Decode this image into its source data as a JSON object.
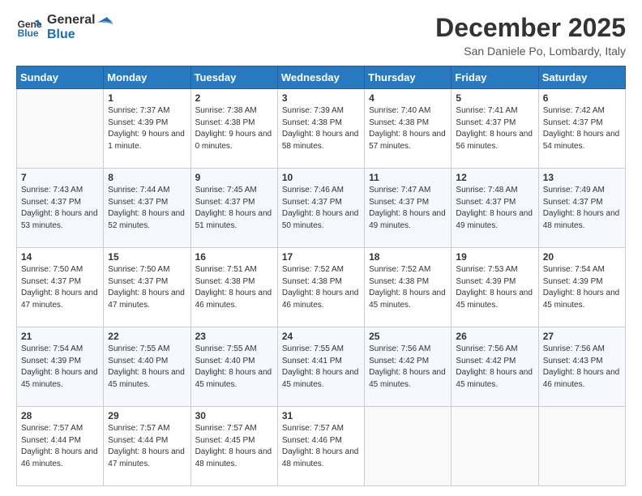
{
  "header": {
    "logo_line1": "General",
    "logo_line2": "Blue",
    "month": "December 2025",
    "location": "San Daniele Po, Lombardy, Italy"
  },
  "weekdays": [
    "Sunday",
    "Monday",
    "Tuesday",
    "Wednesday",
    "Thursday",
    "Friday",
    "Saturday"
  ],
  "weeks": [
    [
      {
        "day": "",
        "sunrise": "",
        "sunset": "",
        "daylight": ""
      },
      {
        "day": "1",
        "sunrise": "Sunrise: 7:37 AM",
        "sunset": "Sunset: 4:39 PM",
        "daylight": "Daylight: 9 hours and 1 minute."
      },
      {
        "day": "2",
        "sunrise": "Sunrise: 7:38 AM",
        "sunset": "Sunset: 4:38 PM",
        "daylight": "Daylight: 9 hours and 0 minutes."
      },
      {
        "day": "3",
        "sunrise": "Sunrise: 7:39 AM",
        "sunset": "Sunset: 4:38 PM",
        "daylight": "Daylight: 8 hours and 58 minutes."
      },
      {
        "day": "4",
        "sunrise": "Sunrise: 7:40 AM",
        "sunset": "Sunset: 4:38 PM",
        "daylight": "Daylight: 8 hours and 57 minutes."
      },
      {
        "day": "5",
        "sunrise": "Sunrise: 7:41 AM",
        "sunset": "Sunset: 4:37 PM",
        "daylight": "Daylight: 8 hours and 56 minutes."
      },
      {
        "day": "6",
        "sunrise": "Sunrise: 7:42 AM",
        "sunset": "Sunset: 4:37 PM",
        "daylight": "Daylight: 8 hours and 54 minutes."
      }
    ],
    [
      {
        "day": "7",
        "sunrise": "Sunrise: 7:43 AM",
        "sunset": "Sunset: 4:37 PM",
        "daylight": "Daylight: 8 hours and 53 minutes."
      },
      {
        "day": "8",
        "sunrise": "Sunrise: 7:44 AM",
        "sunset": "Sunset: 4:37 PM",
        "daylight": "Daylight: 8 hours and 52 minutes."
      },
      {
        "day": "9",
        "sunrise": "Sunrise: 7:45 AM",
        "sunset": "Sunset: 4:37 PM",
        "daylight": "Daylight: 8 hours and 51 minutes."
      },
      {
        "day": "10",
        "sunrise": "Sunrise: 7:46 AM",
        "sunset": "Sunset: 4:37 PM",
        "daylight": "Daylight: 8 hours and 50 minutes."
      },
      {
        "day": "11",
        "sunrise": "Sunrise: 7:47 AM",
        "sunset": "Sunset: 4:37 PM",
        "daylight": "Daylight: 8 hours and 49 minutes."
      },
      {
        "day": "12",
        "sunrise": "Sunrise: 7:48 AM",
        "sunset": "Sunset: 4:37 PM",
        "daylight": "Daylight: 8 hours and 49 minutes."
      },
      {
        "day": "13",
        "sunrise": "Sunrise: 7:49 AM",
        "sunset": "Sunset: 4:37 PM",
        "daylight": "Daylight: 8 hours and 48 minutes."
      }
    ],
    [
      {
        "day": "14",
        "sunrise": "Sunrise: 7:50 AM",
        "sunset": "Sunset: 4:37 PM",
        "daylight": "Daylight: 8 hours and 47 minutes."
      },
      {
        "day": "15",
        "sunrise": "Sunrise: 7:50 AM",
        "sunset": "Sunset: 4:37 PM",
        "daylight": "Daylight: 8 hours and 47 minutes."
      },
      {
        "day": "16",
        "sunrise": "Sunrise: 7:51 AM",
        "sunset": "Sunset: 4:38 PM",
        "daylight": "Daylight: 8 hours and 46 minutes."
      },
      {
        "day": "17",
        "sunrise": "Sunrise: 7:52 AM",
        "sunset": "Sunset: 4:38 PM",
        "daylight": "Daylight: 8 hours and 46 minutes."
      },
      {
        "day": "18",
        "sunrise": "Sunrise: 7:52 AM",
        "sunset": "Sunset: 4:38 PM",
        "daylight": "Daylight: 8 hours and 45 minutes."
      },
      {
        "day": "19",
        "sunrise": "Sunrise: 7:53 AM",
        "sunset": "Sunset: 4:39 PM",
        "daylight": "Daylight: 8 hours and 45 minutes."
      },
      {
        "day": "20",
        "sunrise": "Sunrise: 7:54 AM",
        "sunset": "Sunset: 4:39 PM",
        "daylight": "Daylight: 8 hours and 45 minutes."
      }
    ],
    [
      {
        "day": "21",
        "sunrise": "Sunrise: 7:54 AM",
        "sunset": "Sunset: 4:39 PM",
        "daylight": "Daylight: 8 hours and 45 minutes."
      },
      {
        "day": "22",
        "sunrise": "Sunrise: 7:55 AM",
        "sunset": "Sunset: 4:40 PM",
        "daylight": "Daylight: 8 hours and 45 minutes."
      },
      {
        "day": "23",
        "sunrise": "Sunrise: 7:55 AM",
        "sunset": "Sunset: 4:40 PM",
        "daylight": "Daylight: 8 hours and 45 minutes."
      },
      {
        "day": "24",
        "sunrise": "Sunrise: 7:55 AM",
        "sunset": "Sunset: 4:41 PM",
        "daylight": "Daylight: 8 hours and 45 minutes."
      },
      {
        "day": "25",
        "sunrise": "Sunrise: 7:56 AM",
        "sunset": "Sunset: 4:42 PM",
        "daylight": "Daylight: 8 hours and 45 minutes."
      },
      {
        "day": "26",
        "sunrise": "Sunrise: 7:56 AM",
        "sunset": "Sunset: 4:42 PM",
        "daylight": "Daylight: 8 hours and 45 minutes."
      },
      {
        "day": "27",
        "sunrise": "Sunrise: 7:56 AM",
        "sunset": "Sunset: 4:43 PM",
        "daylight": "Daylight: 8 hours and 46 minutes."
      }
    ],
    [
      {
        "day": "28",
        "sunrise": "Sunrise: 7:57 AM",
        "sunset": "Sunset: 4:44 PM",
        "daylight": "Daylight: 8 hours and 46 minutes."
      },
      {
        "day": "29",
        "sunrise": "Sunrise: 7:57 AM",
        "sunset": "Sunset: 4:44 PM",
        "daylight": "Daylight: 8 hours and 47 minutes."
      },
      {
        "day": "30",
        "sunrise": "Sunrise: 7:57 AM",
        "sunset": "Sunset: 4:45 PM",
        "daylight": "Daylight: 8 hours and 48 minutes."
      },
      {
        "day": "31",
        "sunrise": "Sunrise: 7:57 AM",
        "sunset": "Sunset: 4:46 PM",
        "daylight": "Daylight: 8 hours and 48 minutes."
      },
      {
        "day": "",
        "sunrise": "",
        "sunset": "",
        "daylight": ""
      },
      {
        "day": "",
        "sunrise": "",
        "sunset": "",
        "daylight": ""
      },
      {
        "day": "",
        "sunrise": "",
        "sunset": "",
        "daylight": ""
      }
    ]
  ]
}
